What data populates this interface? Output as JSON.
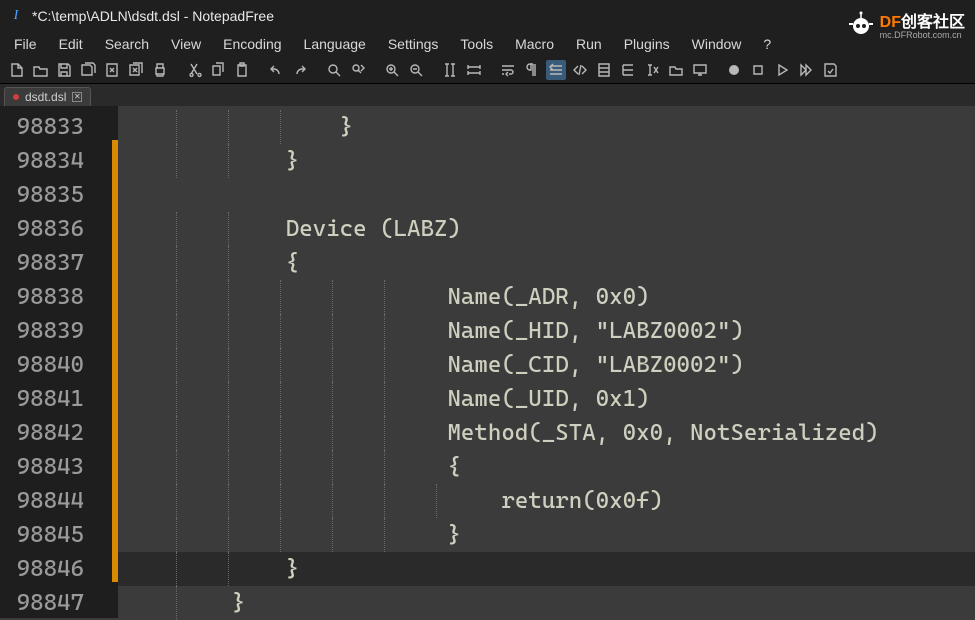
{
  "window": {
    "title": "*C:\\temp\\ADLN\\dsdt.dsl - NotepadFree",
    "app_icon_glyph": "I"
  },
  "logo": {
    "brand_orange": "DF",
    "brand_white": "创客社区",
    "sub": "mc.DFRobot.com.cn"
  },
  "menu": {
    "items": [
      "File",
      "Edit",
      "Search",
      "View",
      "Encoding",
      "Language",
      "Settings",
      "Tools",
      "Macro",
      "Run",
      "Plugins",
      "Window",
      "?"
    ]
  },
  "tab": {
    "filename": "dsdt.dsl"
  },
  "editor": {
    "first_line": 98833,
    "lines": [
      "                }",
      "            }",
      "",
      "            Device (LABZ)",
      "            {",
      "                        Name(_ADR, 0x0)",
      "                        Name(_HID, \"LABZ0002\")",
      "                        Name(_CID, \"LABZ0002\")",
      "                        Name(_UID, 0x1)",
      "                        Method(_STA, 0x0, NotSerialized)",
      "                        {",
      "                            return(0x0f)",
      "                        }",
      "            }",
      "        }"
    ],
    "changed_lines_start": 98834,
    "changed_lines_end": 98846,
    "cursor_line": 98846
  },
  "toolbar_icons": [
    "new-file-icon",
    "open-icon",
    "save-icon",
    "save-all-icon",
    "close-icon",
    "close-all-icon",
    "print-icon",
    "sep",
    "cut-icon",
    "copy-icon",
    "paste-icon",
    "sep",
    "undo-icon",
    "redo-icon",
    "sep",
    "find-icon",
    "replace-icon",
    "sep",
    "zoom-in-icon",
    "zoom-out-icon",
    "sep",
    "sync-v-icon",
    "sync-h-icon",
    "sep",
    "wrap-icon",
    "pilcrow-icon",
    "indent-guide-icon",
    "code-icon",
    "doc-map-icon",
    "func-list-icon",
    "fx-icon",
    "folder-icon",
    "monitor-icon",
    "sep",
    "record-icon",
    "stop-icon",
    "play-icon",
    "play-fast-icon",
    "save-macro-icon"
  ]
}
